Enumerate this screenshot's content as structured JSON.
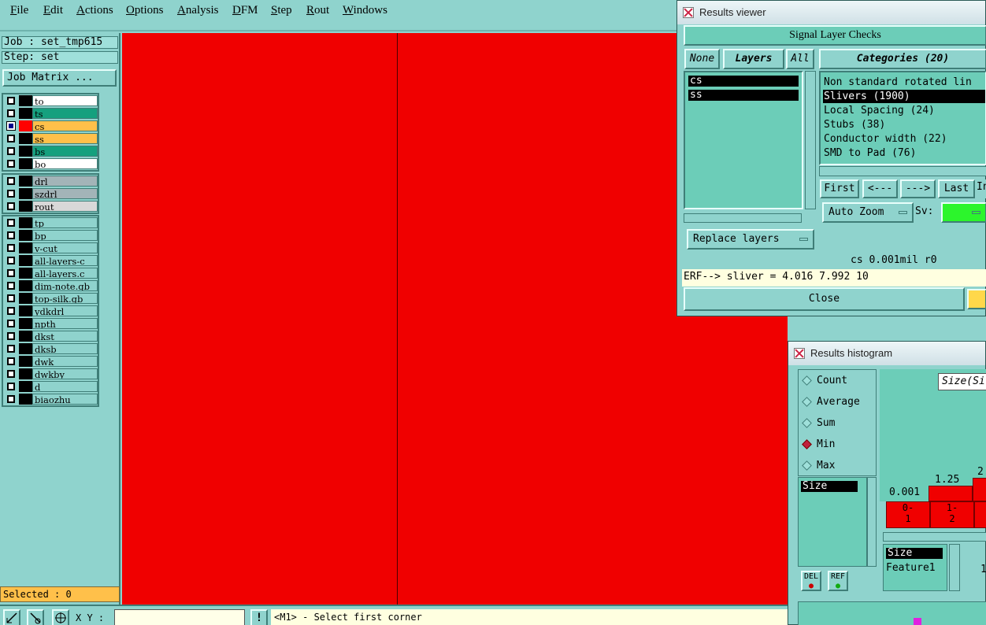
{
  "menu": [
    "File",
    "Edit",
    "Actions",
    "Options",
    "Analysis",
    "DFM",
    "Step",
    "Rout",
    "Windows"
  ],
  "job": {
    "label": "Job : set_tmp615",
    "step": "Step: set",
    "matrix_btn": "Job Matrix ..."
  },
  "layers_group1": [
    {
      "name": "to",
      "color": "#ffffff",
      "checked": false
    },
    {
      "name": "ts",
      "color": "#15a07e",
      "checked": false
    },
    {
      "name": "cs",
      "color": "#ffc04a",
      "checked": true,
      "swatch": "#ff0000"
    },
    {
      "name": "ss",
      "color": "#ffc04a",
      "checked": false
    },
    {
      "name": "bs",
      "color": "#15a07e",
      "checked": false
    },
    {
      "name": "bo",
      "color": "#ffffff",
      "checked": false
    }
  ],
  "layers_group2": [
    {
      "name": "drl",
      "color": "#a3b4b8"
    },
    {
      "name": "szdrl",
      "color": "#a3b4b8"
    },
    {
      "name": "rout",
      "color": "#d8d8d8"
    }
  ],
  "layers_group3": [
    "tp",
    "bp",
    "v-cut",
    "all-layers-c",
    "all-layers.c",
    "dim-note.gb",
    "top-silk.gb",
    "ydkdrl",
    "npth",
    "dkst",
    "dksb",
    "dwk",
    "dwkby",
    "d",
    "biaozhu"
  ],
  "selected": "Selected : 0",
  "statusbar": {
    "xy_label": "X Y :",
    "message": "<M1> - Select first corner"
  },
  "results_viewer": {
    "title": "Results viewer",
    "header": "Signal Layer Checks",
    "none_btn": "None",
    "layers_btn": "Layers",
    "all_btn": "All",
    "categories_label": "Categories (20)",
    "layers": [
      "cs",
      "ss"
    ],
    "categories": [
      "Non standard rotated lin",
      "Slivers (1900)",
      "Local Spacing (24)",
      "Stubs (38)",
      "Conductor width (22)",
      "SMD to Pad (76)"
    ],
    "selected_category": 1,
    "nav": [
      "First",
      "<---",
      "--->",
      "Last",
      "In"
    ],
    "auto_zoom": "Auto Zoom",
    "sv_label": "Sv:",
    "replace_layers": "Replace layers",
    "info": "cs 0.001mil  r0",
    "erf": "ERF--> sliver = 4.016 7.992 10",
    "close": "Close"
  },
  "histogram": {
    "title": "Results histogram",
    "options": [
      "Count",
      "Average",
      "Sum",
      "Min",
      "Max"
    ],
    "selected_option": "Min",
    "list_item": "Size",
    "del": "DEL",
    "ref": "REF",
    "size_btn": "Size(Si",
    "bar_values": [
      "0.001",
      "1.25",
      "2."
    ],
    "bar_labels": [
      "0-\n1",
      "1-\n2"
    ],
    "list2": [
      "Size",
      "Feature1"
    ],
    "list2_extra": "1"
  }
}
